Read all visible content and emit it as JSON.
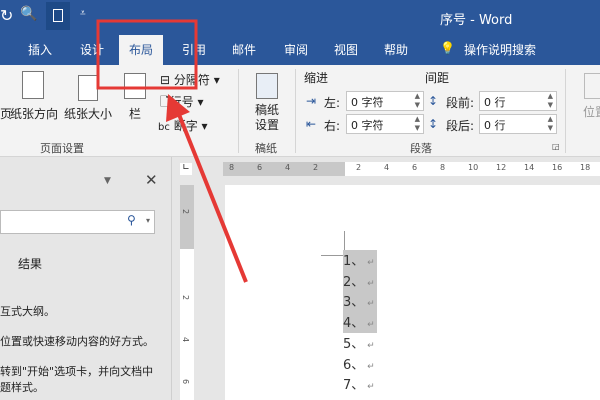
{
  "title_bar": {
    "title": "序号 - Word"
  },
  "tabs": [
    {
      "label": "插入"
    },
    {
      "label": "设计"
    },
    {
      "label": "布局",
      "active": true
    },
    {
      "label": "引用"
    },
    {
      "label": "邮件"
    },
    {
      "label": "审阅"
    },
    {
      "label": "视图"
    },
    {
      "label": "帮助"
    },
    {
      "label": "操作说明搜索"
    }
  ],
  "ribbon": {
    "page_setup": {
      "margins": "页",
      "orientation": "纸张方向",
      "size": "纸张大小",
      "columns": "栏",
      "breaks": "分隔符",
      "line_numbers": "行号",
      "hyphenation": "断字",
      "group": "页面设置"
    },
    "manuscript": {
      "setup": "稿纸设置",
      "group": "稿纸"
    },
    "paragraph": {
      "indent": "缩进",
      "spacing": "间距",
      "left": "左:",
      "right": "右:",
      "before": "段前:",
      "after": "段后:",
      "left_val": "0 字符",
      "right_val": "0 字符",
      "before_val": "0 行",
      "after_val": "0 行",
      "group": "段落"
    },
    "position": "位置"
  },
  "nav_pane": {
    "results_tab": "结果",
    "text1": "互式大纲。",
    "text2": "位置或快速移动内容的好方式。",
    "text3": "转到\"开始\"选项卡，并向文档中",
    "text4": "题样式。"
  },
  "ruler": {
    "h_ticks": [
      "8",
      "6",
      "4",
      "2",
      "2",
      "4",
      "6",
      "8",
      "10",
      "12",
      "14",
      "16",
      "18"
    ],
    "v_ticks": [
      "2",
      "2",
      "4",
      "6"
    ]
  },
  "document": {
    "lines": [
      "1、",
      "2、",
      "3、",
      "4、",
      "5、",
      "6、",
      "7、"
    ],
    "selected_count": 4
  },
  "annotation_color": "#e53935"
}
